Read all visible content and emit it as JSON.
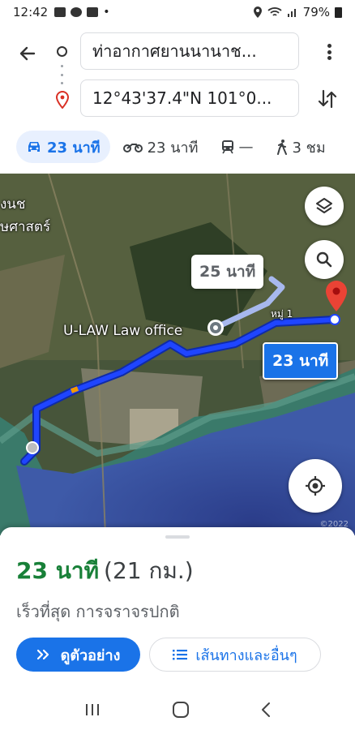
{
  "status_bar": {
    "time": "12:42",
    "battery": "79%"
  },
  "directions": {
    "origin": "ท่าอากาศยานนานาช...",
    "destination": "12°43'37.4\"N 101°0..."
  },
  "modes": [
    {
      "name": "car",
      "label": "23 นาที",
      "active": true
    },
    {
      "name": "motorcycle",
      "label": "23 นาที",
      "active": false
    },
    {
      "name": "transit",
      "label": "—",
      "active": false
    },
    {
      "name": "walk",
      "label": "3 ชม",
      "active": false
    }
  ],
  "map": {
    "place_label": "U-LAW Law office",
    "area_label_1": "งนช",
    "area_label_2": "ษศาสตร์",
    "road_label": "หมู่ 1",
    "alt_route_time": "25 นาที",
    "main_route_time": "23 นาที",
    "copyright": "©2022"
  },
  "sheet": {
    "duration": "23 นาที",
    "distance": "(21 กม.)",
    "subtitle": "เร็วที่สุด การจราจรปกติ",
    "preview_label": "ดูตัวอย่าง",
    "steps_label": "เส้นทางและอื่นๆ"
  },
  "colors": {
    "accent": "#1a73e8",
    "route": "#1a3cff",
    "duration": "#188038"
  }
}
